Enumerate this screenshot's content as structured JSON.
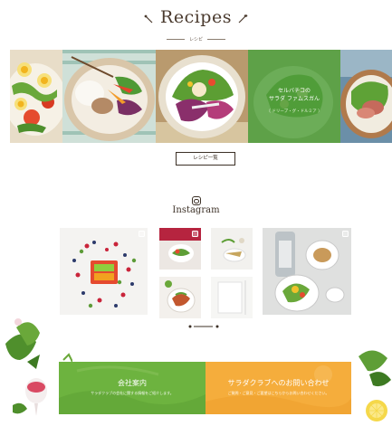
{
  "recipes": {
    "title": "Recipes",
    "subtitle": "レシピ",
    "list_button": "レシピ一覧",
    "featured_overlay": {
      "line1": "セルバチコの",
      "line2": "サラダ ファムスガん",
      "line3": "〔 ドリーブ・グ・ドルミア 〕"
    }
  },
  "instagram": {
    "icon": "instagram-icon",
    "label": "Instagram"
  },
  "banners": {
    "company": {
      "title": "会社案内",
      "subtitle": "サラダクラブの会社に関する情報をご紹介します。"
    },
    "contact": {
      "title": "サラダクラブへのお問い合わせ",
      "subtitle": "ご質問・ご意見・ご要望はこちらからお問い合わせください。"
    }
  },
  "colors": {
    "green": "#6db33f",
    "orange": "#f5ad3c",
    "text": "#3c3026"
  }
}
